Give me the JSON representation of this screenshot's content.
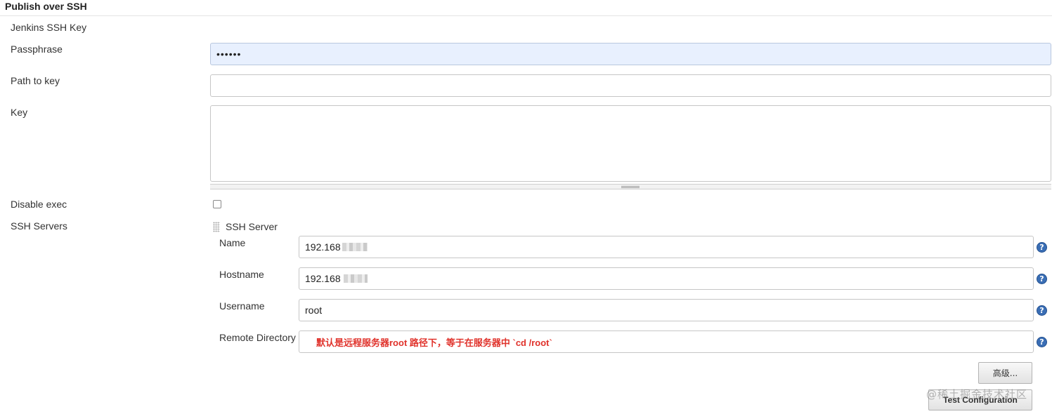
{
  "section": {
    "title": "Publish over SSH"
  },
  "fields": {
    "jenkins_ssh_key_label": "Jenkins SSH Key",
    "passphrase_label": "Passphrase",
    "passphrase_value": "••••••",
    "path_to_key_label": "Path to key",
    "path_to_key_value": "",
    "key_label": "Key",
    "key_value": "",
    "disable_exec_label": "Disable exec",
    "disable_exec_checked": false
  },
  "ssh_servers": {
    "label": "SSH Servers",
    "server_header": "SSH Server",
    "name_label": "Name",
    "name_value": "192.168",
    "hostname_label": "Hostname",
    "hostname_value": "192.168",
    "username_label": "Username",
    "username_value": "root",
    "remote_directory_label": "Remote Directory",
    "remote_directory_note": "默认是远程服务器root 路径下，等于在服务器中 `cd /root`",
    "help_glyph": "?",
    "help_icon": "question-circle-icon"
  },
  "buttons": {
    "advanced": "高级...",
    "test_configuration": "Test Configuration"
  },
  "watermark": "@稀土掘金技术社区",
  "colors": {
    "password_bg": "#e8f0fe",
    "help_icon": "#3a6eb5",
    "note_red": "#e0322b"
  }
}
